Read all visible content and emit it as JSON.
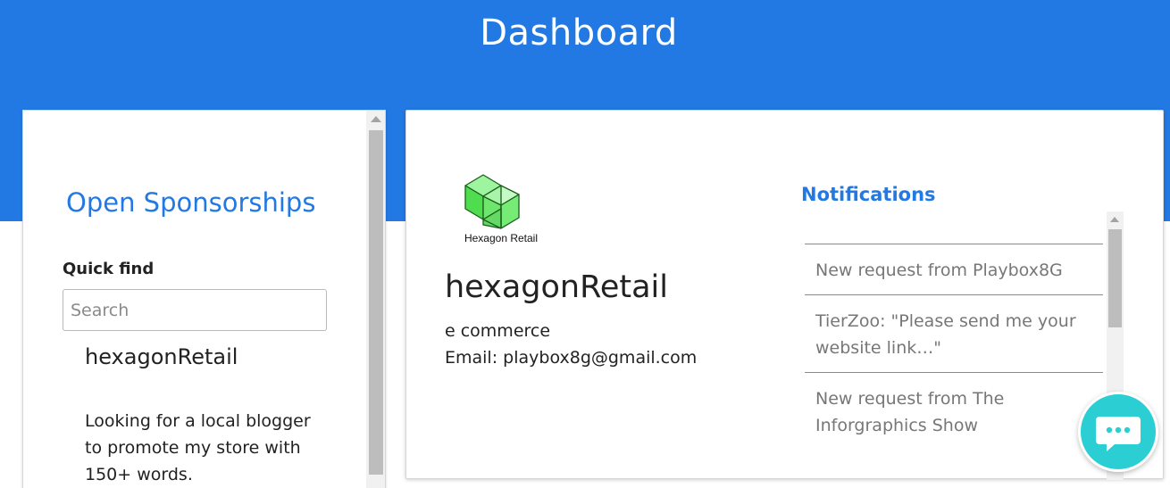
{
  "header": {
    "title": "Dashboard"
  },
  "sponsorships": {
    "title": "Open Sponsorships",
    "quick_find_label": "Quick find",
    "search_placeholder": "Search",
    "item": {
      "name": "hexagonRetail",
      "description": "Looking for a local blogger to promote my store with 150+ words."
    }
  },
  "profile": {
    "logo_caption": "Hexagon Retail",
    "name": "hexagonRetail",
    "category": "e commerce",
    "email": "Email: playbox8g@gmail.com"
  },
  "notifications": {
    "title": "Notifications",
    "items": [
      "New request from Playbox8G",
      "TierZoo: \"Please send me your website link…\"",
      "New request from The Inforgraphics Show"
    ]
  },
  "colors": {
    "primary": "#2279e3",
    "chat_button": "#2bcfd3",
    "logo_green": "#5ee85e"
  },
  "icons": {
    "chat": "chat-bubble-icon",
    "logo": "hexagon-cube-logo"
  }
}
